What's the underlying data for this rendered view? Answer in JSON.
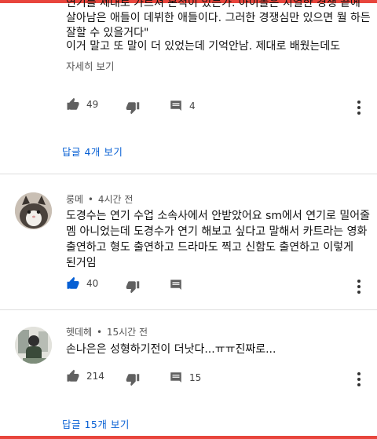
{
  "comment1": {
    "lines": [
      "연기를 제대로 가르쳐 본적이 있는가. 아이돌은 치열한 경쟁 끝에",
      "살아남은 애들이 데뷔한 애들이다. 그러한 경쟁심만 있으면 뭘 하든",
      "잘할 수 있을거다\"",
      "이거 말고 또 말이 더 있었는데 기억안남. 제대로 배웠는데도"
    ],
    "more_label": "자세히 보기",
    "likes": "49",
    "replies_count": "4",
    "view_replies_label": "답글 4개 보기"
  },
  "comment2": {
    "author": "룽메",
    "time": "4시간 전",
    "lines": [
      "도경수는 연기 수업 소속사에서 안받았어요 sm에서 연기로 밀어줄",
      "멤 아니었는데 도경수가 연기 해보고 싶다고 말해서 카트라는 영화",
      "출연하고 형도 출연하고 드라마도 찍고 신함도 출연하고 이렇게",
      "된거임"
    ],
    "likes": "40"
  },
  "comment3": {
    "author": "헷데헤",
    "time": "15시간 전",
    "lines": [
      "손나은은 성형하기전이 더낫다...ㅠㅠ진짜로..."
    ],
    "likes": "214",
    "replies_count": "15",
    "view_replies_label": "답글 15개 보기"
  },
  "colors": {
    "link_blue": "#065fd4",
    "liked_blue": "#065fd4",
    "icon_gray": "#606060",
    "accent_red": "#e8453c"
  },
  "icons": [
    "thumb-up-icon",
    "thumb-down-icon",
    "comment-icon",
    "more-vert-icon"
  ]
}
